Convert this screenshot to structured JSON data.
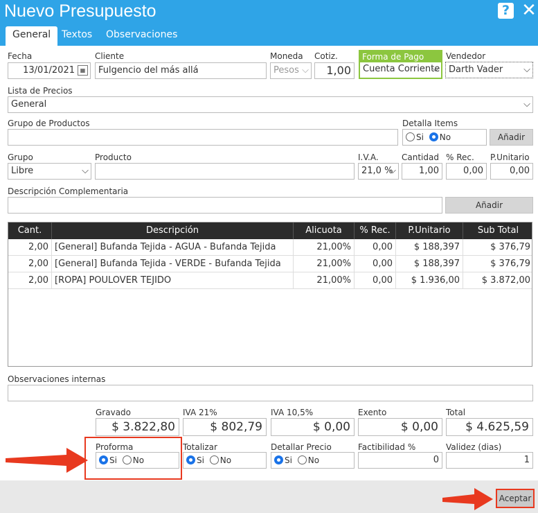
{
  "dialog": {
    "title": "Nuevo Presupuesto"
  },
  "tabs": [
    {
      "label": "General",
      "active": true
    },
    {
      "label": "Textos",
      "active": false
    },
    {
      "label": "Observaciones",
      "active": false
    }
  ],
  "header": {
    "fecha_label": "Fecha",
    "fecha_value": "13/01/2021",
    "cliente_label": "Cliente",
    "cliente_value": "Fulgencio del más allá",
    "moneda_label": "Moneda",
    "moneda_value": "Pesos",
    "cotiz_label": "Cotiz.",
    "cotiz_value": "1,00",
    "forma_pago_label": "Forma de Pago",
    "forma_pago_value": "Cuenta Corriente",
    "vendedor_label": "Vendedor",
    "vendedor_value": "Darth Vader"
  },
  "lista_precios": {
    "label": "Lista de Precios",
    "value": "General"
  },
  "grupo_productos": {
    "label": "Grupo de Productos",
    "value": ""
  },
  "detalla_items": {
    "label": "Detalla Items",
    "si": "Si",
    "no": "No",
    "selected": "No",
    "add_label": "Añadir"
  },
  "product_line": {
    "grupo_label": "Grupo",
    "grupo_value": "Libre",
    "producto_label": "Producto",
    "producto_value": "",
    "iva_label": "I.V.A.",
    "iva_value": "21,0 %",
    "cantidad_label": "Cantidad",
    "cantidad_value": "1,00",
    "rec_label": "% Rec.",
    "rec_value": "0,00",
    "punit_label": "P.Unitario",
    "punit_value": "0,00"
  },
  "desc_comp": {
    "label": "Descripción Complementaria",
    "value": "",
    "add_label": "Añadir"
  },
  "grid": {
    "columns": [
      "Cant.",
      "Descripción",
      "Alicuota",
      "% Rec.",
      "P.Unitario",
      "Sub Total"
    ],
    "rows": [
      {
        "cant": "2,00",
        "desc": "[General] Bufanda Tejida - AGUA - Bufanda Tejida",
        "alic": "21,00%",
        "rec": "0,00",
        "punit": "$ 188,397",
        "subtotal": "$ 376,79"
      },
      {
        "cant": "2,00",
        "desc": "[General] Bufanda Tejida - VERDE - Bufanda Tejida",
        "alic": "21,00%",
        "rec": "0,00",
        "punit": "$ 188,397",
        "subtotal": "$ 376,79"
      },
      {
        "cant": "2,00",
        "desc": "[ROPA] POULOVER TEJIDO",
        "alic": "21,00%",
        "rec": "0,00",
        "punit": "$ 1.936,00",
        "subtotal": "$ 3.872,00"
      }
    ]
  },
  "observaciones": {
    "label": "Observaciones internas",
    "value": ""
  },
  "totals": {
    "gravado_label": "Gravado",
    "gravado_value": "$ 3.822,80",
    "iva21_label": "IVA 21%",
    "iva21_value": "$ 802,79",
    "iva105_label": "IVA 10,5%",
    "iva105_value": "$ 0,00",
    "exento_label": "Exento",
    "exento_value": "$ 0,00",
    "total_label": "Total",
    "total_value": "$ 4.625,59"
  },
  "options": {
    "proforma_label": "Proforma",
    "proforma_selected": "Si",
    "totalizar_label": "Totalizar",
    "totalizar_selected": "Si",
    "detallar_label": "Detallar Precio",
    "detallar_selected": "Si",
    "si": "Si",
    "no": "No",
    "factibilidad_label": "Factibilidad %",
    "factibilidad_value": "0",
    "validez_label": "Validez (dias)",
    "validez_value": "1"
  },
  "footer": {
    "accept_label": "Aceptar"
  },
  "colors": {
    "titlebar": "#2fa4e7",
    "highlight": "#e8391f",
    "forma_pago_accent": "#8cc63f",
    "grid_header": "#2b2b2b"
  }
}
